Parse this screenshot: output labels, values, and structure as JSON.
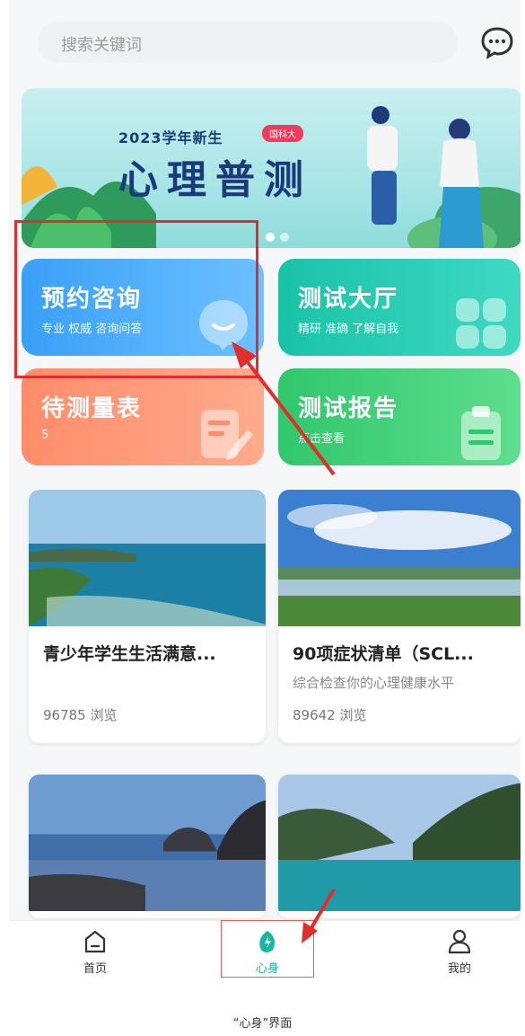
{
  "search": {
    "placeholder": "搜索关键词"
  },
  "banner": {
    "year": "2023学年新生",
    "badge": "国科大",
    "title": "心理普测"
  },
  "features": [
    {
      "title": "预约咨询",
      "sub": "专业 权威 咨询问答"
    },
    {
      "title": "测试大厅",
      "sub": "精研 准确 了解自我"
    },
    {
      "title": "待测量表",
      "sub": "5"
    },
    {
      "title": "测试报告",
      "sub": "点击查看"
    }
  ],
  "articles": [
    {
      "title": "青少年学生生活满意...",
      "desc": "",
      "views": "96785 浏览"
    },
    {
      "title": "90项症状清单（SCL...",
      "desc": "综合检查你的心理健康水平",
      "views": "89642 浏览"
    }
  ],
  "tabbar": [
    {
      "label": "首页"
    },
    {
      "label": "心身"
    },
    {
      "label": "我的"
    }
  ],
  "caption": "“心身”界面",
  "colors": {
    "accent": "#16b8a0",
    "annotation": "#e32d2d"
  }
}
